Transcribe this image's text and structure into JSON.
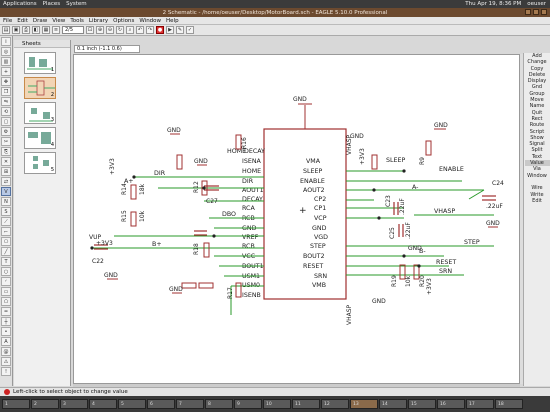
{
  "topbar": {
    "menus": [
      "Applications",
      "Places",
      "System"
    ],
    "user": "oeuser",
    "datetime": "Thu Apr 19,  8:36 PM"
  },
  "window": {
    "title": "2 Schematic - /home/oeuser/Desktop/MotorBoard.sch - EAGLE 5.10.0 Professional"
  },
  "menubar": [
    "File",
    "Edit",
    "Draw",
    "View",
    "Tools",
    "Library",
    "Options",
    "Window",
    "Help"
  ],
  "toolbar": {
    "sheet_select": "2/5"
  },
  "sheets_panel": {
    "header": "Sheets",
    "sheet_numbers": [
      "1",
      "2",
      "3",
      "4",
      "5"
    ]
  },
  "coord": {
    "value": "0.1 inch (-1.1 0.6)"
  },
  "commands": [
    "Add",
    "Change",
    "Copy",
    "Delete",
    "Display",
    "Gnd",
    "Group",
    "Move",
    "Name",
    "Quit",
    "Rect",
    "Route",
    "Script",
    "Show",
    "Signal",
    "Split",
    "Text",
    "Value",
    "Via",
    "Window",
    "",
    "Wire",
    "Write",
    "Edit"
  ],
  "active_command": "Value",
  "status": {
    "text": "Left-click to select object to change value"
  },
  "taskbar": [
    "1",
    "2",
    "3",
    "4",
    "5",
    "6",
    "7",
    "8",
    "9",
    "10",
    "11",
    "12",
    "13",
    "14",
    "15",
    "16",
    "17",
    "18"
  ],
  "schematic": {
    "chip_left_pins": [
      "ISENA",
      "HOME",
      "DIR",
      "AOUT1",
      "DECAY",
      "RCA",
      "RCB",
      "GND",
      "VREF",
      "RCB",
      "VCC",
      "BOUT1",
      "USM1",
      "USM0",
      "ISENB"
    ],
    "chip_right_pins": [
      "VMA",
      "SLEEP",
      "ENABLE",
      "AOUT2",
      "CP2",
      "CP1",
      "VCP",
      "GND",
      "VGD",
      "STEP",
      "BOUT2",
      "RESET",
      "SRN",
      "VMB"
    ],
    "net_labels": [
      "SLEEP",
      "ENABLE",
      "A-",
      "VHASP",
      "STEP",
      "B-",
      "RESET",
      "SRN",
      "A+",
      "B+",
      "DIR",
      "DBO",
      "HOME",
      "DECAY"
    ],
    "parts": {
      "r14": "R14",
      "r14v": "18k",
      "r15": "R15",
      "r15v": "10k",
      "r12": "R12",
      "r16": "R16",
      "r17": "R17",
      "r18": "R18",
      "r9": "R9",
      "r19": "R19",
      "r19v": "10k",
      "r20": "R20",
      "c27": "C27",
      "c22": "C22",
      "c24": "C24",
      "c24v": ".22uF",
      "c23": "C23",
      "c23v": ".22uF",
      "c25": "C25",
      "c25v": ".22uF"
    },
    "power": {
      "gnd": "GND",
      "v33": "+3V3",
      "vhasp": "VHASP",
      "vup": "+3V3",
      "v_plus": "VUP"
    },
    "chip_pin_top": "GND"
  }
}
